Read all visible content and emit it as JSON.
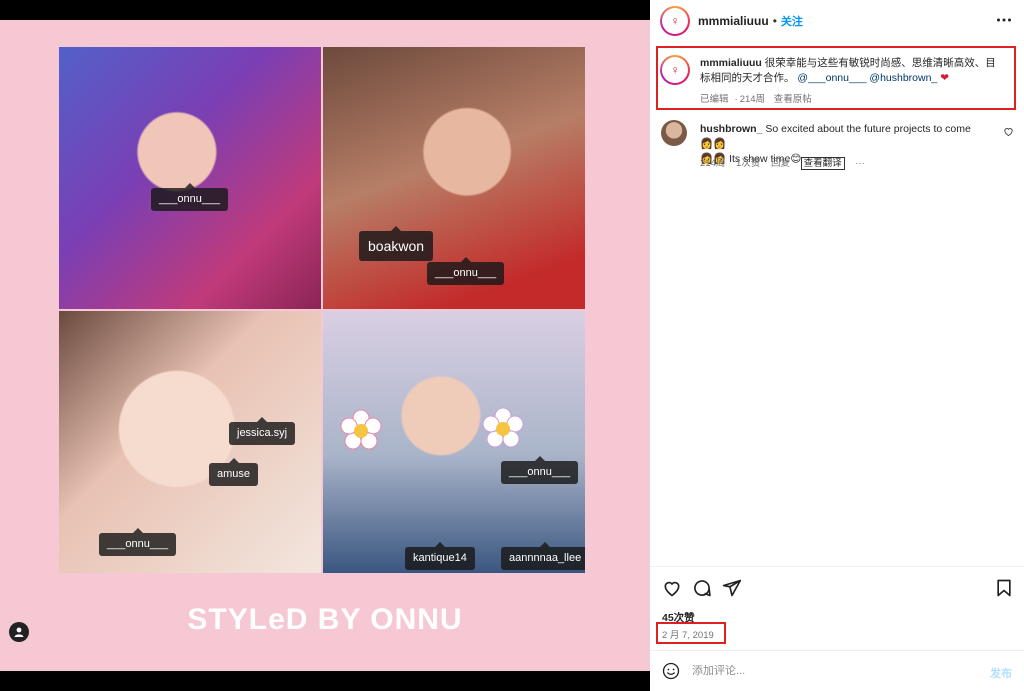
{
  "post": {
    "username": "mmmialiuuu",
    "separator": "•",
    "follow_label": "关注",
    "more_icon": "more-dots-icon"
  },
  "media": {
    "poster_title": "STYLeD BY ONNU",
    "tags": {
      "photo1": [
        "___onnu___"
      ],
      "photo2": [
        "boakwon",
        "___onnu___"
      ],
      "photo3": [
        "jessica.syj",
        "amuse",
        "___onnu___"
      ],
      "photo4": [
        "___onnu___",
        "kantique14",
        "aannnnaa_llee"
      ]
    }
  },
  "caption": {
    "username": "mmmialiuuu",
    "text": "很荣幸能与这些有敏锐时尚感、思维清晰高效、目标相同的天才合作。",
    "mentions": [
      "@___onnu___",
      "@hushbrown_"
    ],
    "emoji": "❤",
    "edited": "已编辑",
    "sep": "·",
    "age": "214周",
    "view_original": "查看原帖"
  },
  "comment": {
    "username": "hushbrown_",
    "text": "So excited about the future projects to come",
    "text2": "Its show time",
    "emoji_a": "👩‍👩",
    "emoji_b": "👩‍👩",
    "emoji_c": "😊",
    "age": "214周",
    "likes": "1次赞",
    "reply": "回复",
    "translate": "查看翻译",
    "more": "···"
  },
  "footer": {
    "likes_count": "45次赞",
    "date": "2 月 7, 2019",
    "comment_placeholder": "添加评论...",
    "publish_label": "发布"
  },
  "colors": {
    "accent": "#0095f6",
    "highlight_box": "#e01f1f",
    "poster_bg": "#f6c8d3"
  }
}
